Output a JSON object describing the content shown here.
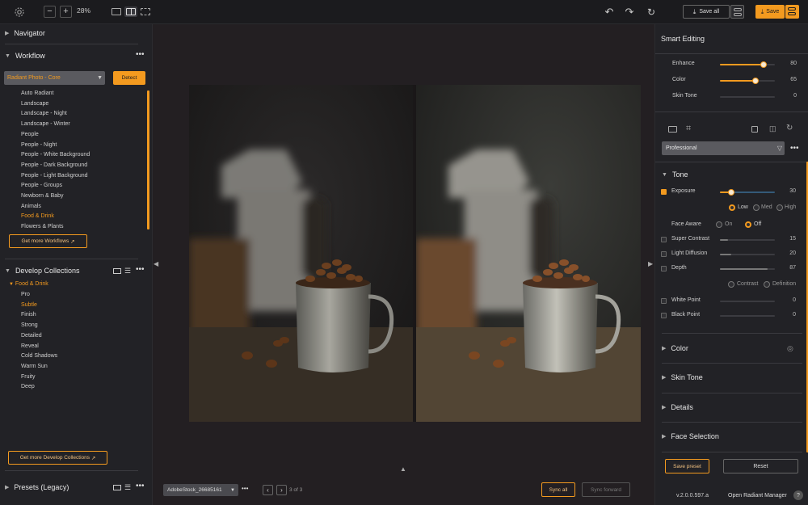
{
  "topbar": {
    "zoom": "28%",
    "zoom_out": "−",
    "zoom_in": "+",
    "save_all_label": "Save all",
    "save_label": "Save"
  },
  "left": {
    "navigator_title": "Navigator",
    "workflow_title": "Workflow",
    "workflow_select": "Radiant Photo - Core",
    "detect_label": "Detect",
    "workflow_items": [
      "Auto Radiant",
      "Landscape",
      "Landscape - Night",
      "Landscape - Winter",
      "People",
      "People - Night",
      "People - White Background",
      "People - Dark Background",
      "People - Light Background",
      "People - Groups",
      "Newborn & Baby",
      "Animals",
      "Food & Drink",
      "Flowers & Plants"
    ],
    "workflow_active": "Food & Drink",
    "get_workflows": "Get more Workflows",
    "collections_title": "Develop Collections",
    "collection_group": "Food & Drink",
    "collection_items": [
      "Pro",
      "Subtle",
      "Finish",
      "Strong",
      "Detailed",
      "Reveal",
      "Cold Shadows",
      "Warm Sun",
      "Fruity",
      "Deep"
    ],
    "collection_active": "Subtle",
    "get_collections": "Get more Develop Collections",
    "presets_title": "Presets (Legacy)"
  },
  "center": {
    "filename": "AdobeStock_26685161",
    "page_info": "3 of 3",
    "sync_all": "Sync all",
    "sync_forward": "Sync forward"
  },
  "right": {
    "smart_title": "Smart Editing",
    "smart_sliders": [
      {
        "label": "Enhance",
        "value": 80
      },
      {
        "label": "Color",
        "value": 65
      },
      {
        "label": "Skin Tone",
        "value": 0
      }
    ],
    "profile_select": "Professional",
    "tone_title": "Tone",
    "exposure_label": "Exposure",
    "exposure_value": 30,
    "exposure_modes": [
      "Low",
      "Med",
      "High"
    ],
    "exposure_mode_selected": "Low",
    "face_aware_label": "Face Aware",
    "face_aware_on": "On",
    "face_aware_off": "Off",
    "face_aware_selected": "Off",
    "tone_sliders": [
      {
        "label": "Super Contrast",
        "value": 15
      },
      {
        "label": "Light Diffusion",
        "value": 20
      },
      {
        "label": "Depth",
        "value": 87
      }
    ],
    "depth_modes": [
      "Contrast",
      "Definition"
    ],
    "point_sliders": [
      {
        "label": "White Point",
        "value": 0
      },
      {
        "label": "Black Point",
        "value": 0
      }
    ],
    "sections": [
      "Color",
      "Skin Tone",
      "Details",
      "Face Selection"
    ],
    "save_preset": "Save preset",
    "reset": "Reset",
    "version": "v.2.0.0.597.a",
    "open_manager": "Open Radiant Manager",
    "help": "?"
  },
  "colors": {
    "accent": "#f39a1f",
    "panel": "#222226",
    "canvas": "#231f22"
  }
}
